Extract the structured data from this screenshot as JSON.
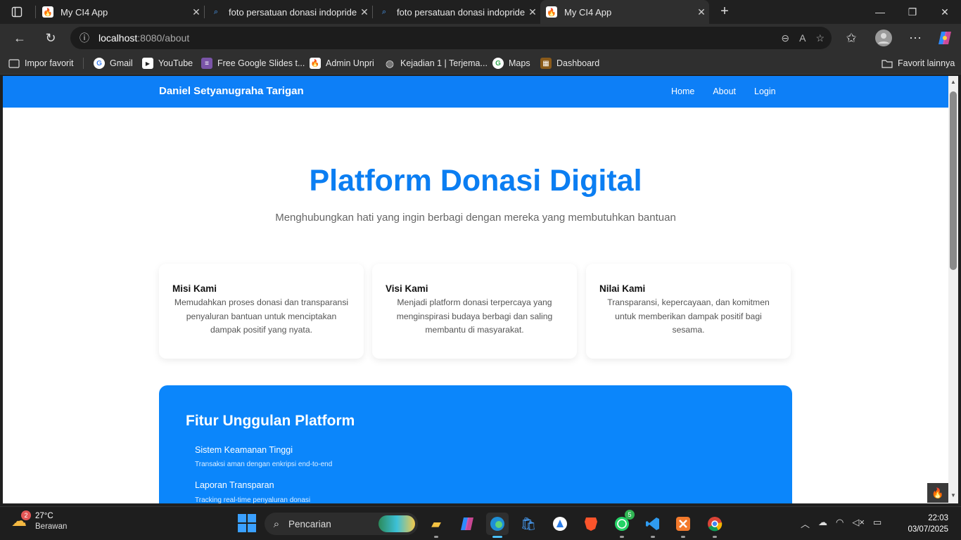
{
  "browser": {
    "tabs": [
      {
        "title": "My CI4 App",
        "active": false
      },
      {
        "title": "foto persatuan donasi indopride",
        "active": false
      },
      {
        "title": "foto persatuan donasi indopride",
        "active": false
      },
      {
        "title": "My CI4 App",
        "active": true
      }
    ],
    "url_host": "localhost",
    "url_path": ":8080/about",
    "bookmarks": [
      {
        "label": "Impor favorit",
        "icon": "folder-import-icon"
      },
      {
        "label": "Gmail",
        "icon": "google-icon"
      },
      {
        "label": "YouTube",
        "icon": "youtube-icon"
      },
      {
        "label": "Free Google Slides t...",
        "icon": "slides-icon"
      },
      {
        "label": "Admin Unpri",
        "icon": "codeigniter-icon"
      },
      {
        "label": "Kejadian 1 | Terjema...",
        "icon": "globe-icon"
      },
      {
        "label": "Maps",
        "icon": "google-icon"
      },
      {
        "label": "Dashboard",
        "icon": "dashboard-icon"
      }
    ],
    "other_favorites": "Favorit lainnya"
  },
  "site": {
    "brand": "Daniel Setyanugraha Tarigan",
    "menu": [
      "Home",
      "About",
      "Login"
    ],
    "hero_title": "Platform Donasi Digital",
    "hero_subtitle": "Menghubungkan hati yang ingin berbagi dengan mereka yang membutuhkan bantuan",
    "cards": [
      {
        "title": "Misi Kami",
        "text": "Memudahkan proses donasi dan transparansi penyaluran bantuan untuk menciptakan dampak positif yang nyata."
      },
      {
        "title": "Visi Kami",
        "text": "Menjadi platform donasi terpercaya yang menginspirasi budaya berbagi dan saling membantu di masyarakat."
      },
      {
        "title": "Nilai Kami",
        "text": "Transparansi, kepercayaan, dan komitmen untuk memberikan dampak positif bagi sesama."
      }
    ],
    "features_title": "Fitur Unggulan Platform",
    "features": [
      {
        "title": "Sistem Keamanan Tinggi",
        "desc": "Transaksi aman dengan enkripsi end-to-end"
      },
      {
        "title": "Laporan Transparan",
        "desc": "Tracking real-time penyaluran donasi"
      }
    ]
  },
  "taskbar": {
    "weather_temp": "27°C",
    "weather_cond": "Berawan",
    "weather_badge": "2",
    "search_placeholder": "Pencarian",
    "whatsapp_badge": "5",
    "time": "22:03",
    "date": "03/07/2025"
  },
  "colors": {
    "primary": "#0d7ff7",
    "hero_title": "#0b7ef2",
    "feature_bg": "#0b86fb"
  }
}
